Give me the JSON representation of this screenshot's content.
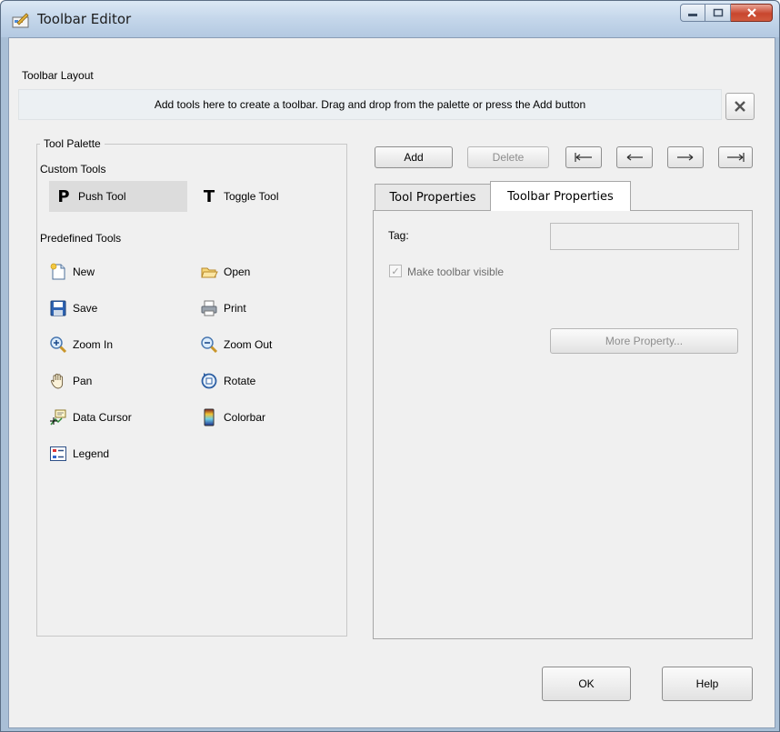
{
  "window": {
    "title": "Toolbar Editor"
  },
  "toolbar_layout": {
    "label": "Toolbar Layout",
    "hint": "Add tools here to create a toolbar. Drag and drop from the palette or press the Add button"
  },
  "palette": {
    "title": "Tool Palette",
    "custom_label": "Custom Tools",
    "custom_tools": [
      {
        "label": "Push Tool",
        "icon": "push-tool-icon",
        "glyph": "P",
        "selected": true
      },
      {
        "label": "Toggle Tool",
        "icon": "toggle-tool-icon",
        "glyph": "T",
        "selected": false
      }
    ],
    "predefined_label": "Predefined Tools",
    "predefined_tools": [
      {
        "label": "New",
        "icon": "new-document-icon"
      },
      {
        "label": "Open",
        "icon": "open-folder-icon"
      },
      {
        "label": "Save",
        "icon": "save-disk-icon"
      },
      {
        "label": "Print",
        "icon": "printer-icon"
      },
      {
        "label": "Zoom In",
        "icon": "zoom-in-icon"
      },
      {
        "label": "Zoom Out",
        "icon": "zoom-out-icon"
      },
      {
        "label": "Pan",
        "icon": "pan-hand-icon"
      },
      {
        "label": "Rotate",
        "icon": "rotate-icon"
      },
      {
        "label": "Data Cursor",
        "icon": "data-cursor-icon"
      },
      {
        "label": "Colorbar",
        "icon": "colorbar-icon"
      },
      {
        "label": "Legend",
        "icon": "legend-icon"
      }
    ]
  },
  "actions": {
    "add": "Add",
    "delete": "Delete",
    "move_first_icon": "move-to-start-icon",
    "move_left_icon": "move-left-icon",
    "move_right_icon": "move-right-icon",
    "move_last_icon": "move-to-end-icon"
  },
  "tabs": [
    {
      "label": "Tool Properties",
      "active": false
    },
    {
      "label": "Toolbar Properties",
      "active": true
    }
  ],
  "toolbar_properties": {
    "tag_label": "Tag:",
    "tag_value": "",
    "visible_label": "Make toolbar visible",
    "visible_checked": true,
    "more_button": "More Property..."
  },
  "footer": {
    "ok": "OK",
    "help": "Help"
  }
}
